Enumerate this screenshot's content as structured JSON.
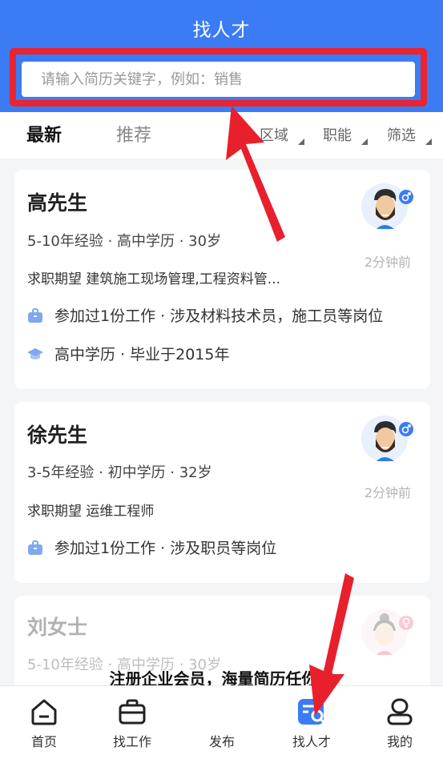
{
  "header": {
    "title": "找人才"
  },
  "search": {
    "placeholder": "请输入简历关键字，例如：销售"
  },
  "tabs": [
    {
      "label": "最新",
      "active": true
    },
    {
      "label": "推荐",
      "active": false
    }
  ],
  "filters": [
    {
      "label": "区域"
    },
    {
      "label": "职能"
    },
    {
      "label": "筛选"
    }
  ],
  "cards": [
    {
      "name": "高先生",
      "meta": "5-10年经验 · 高中学历 · 30岁",
      "expect": "求职期望 建筑施工现场管理,工程资料管...",
      "time": "2分钟前",
      "work": "参加过1份工作 · 涉及材料技术员，施工员等岗位",
      "edu": "高中学历 · 毕业于2015年",
      "gender": "male"
    },
    {
      "name": "徐先生",
      "meta": "3-5年经验 · 初中学历 · 32岁",
      "expect": "求职期望 运维工程师",
      "time": "2分钟前",
      "work": "参加过1份工作 · 涉及职员等岗位",
      "gender": "male"
    },
    {
      "name": "刘女士",
      "meta": "5-10年经验 · 高中学历 · 30岁",
      "gender": "female"
    }
  ],
  "promo": "注册企业会员，海量简历任你选",
  "tabbar": [
    {
      "label": "首页",
      "icon": "home-icon"
    },
    {
      "label": "找工作",
      "icon": "briefcase-icon"
    },
    {
      "label": "发布",
      "icon": "publish-icon"
    },
    {
      "label": "找人才",
      "icon": "find-talent-icon",
      "active": true
    },
    {
      "label": "我的",
      "icon": "profile-icon"
    }
  ],
  "colors": {
    "header": "#3b7cf5",
    "highlight": "#ea2430",
    "accent": "#3b7cf5"
  }
}
